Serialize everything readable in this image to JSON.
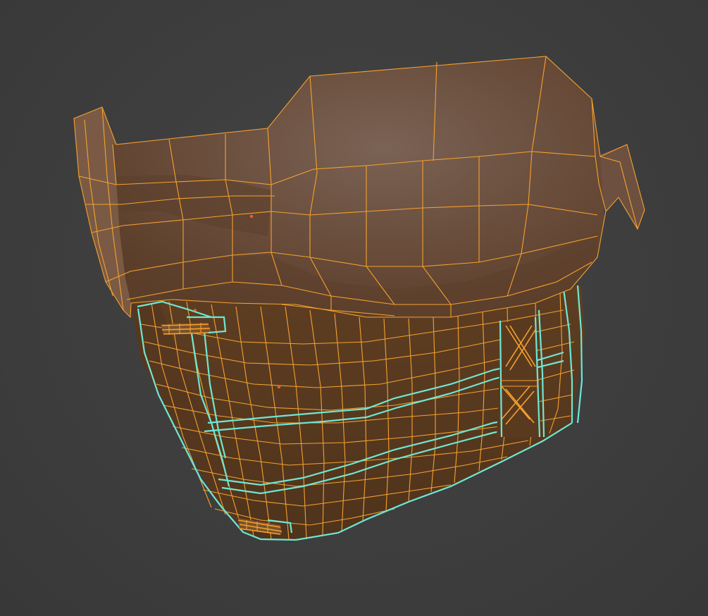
{
  "viewport": {
    "background_color": "#3d3d3d",
    "mode": "edit-mode-wireframe-overlay"
  },
  "colors": {
    "selected_wire": "#f5a12e",
    "seam_edge": "#6fe7d2",
    "mesh_top_fill": "#6e5444",
    "mesh_band_fill": "#5b3d24",
    "mesh_dark_fill": "#4a3019",
    "active_vertex": "#ff5a1e"
  },
  "mesh": {
    "object": "strap-harness-mesh",
    "parts": [
      "top-shell",
      "strap-band",
      "lace-cross",
      "buckle-left-top",
      "buckle-left-bottom"
    ]
  }
}
